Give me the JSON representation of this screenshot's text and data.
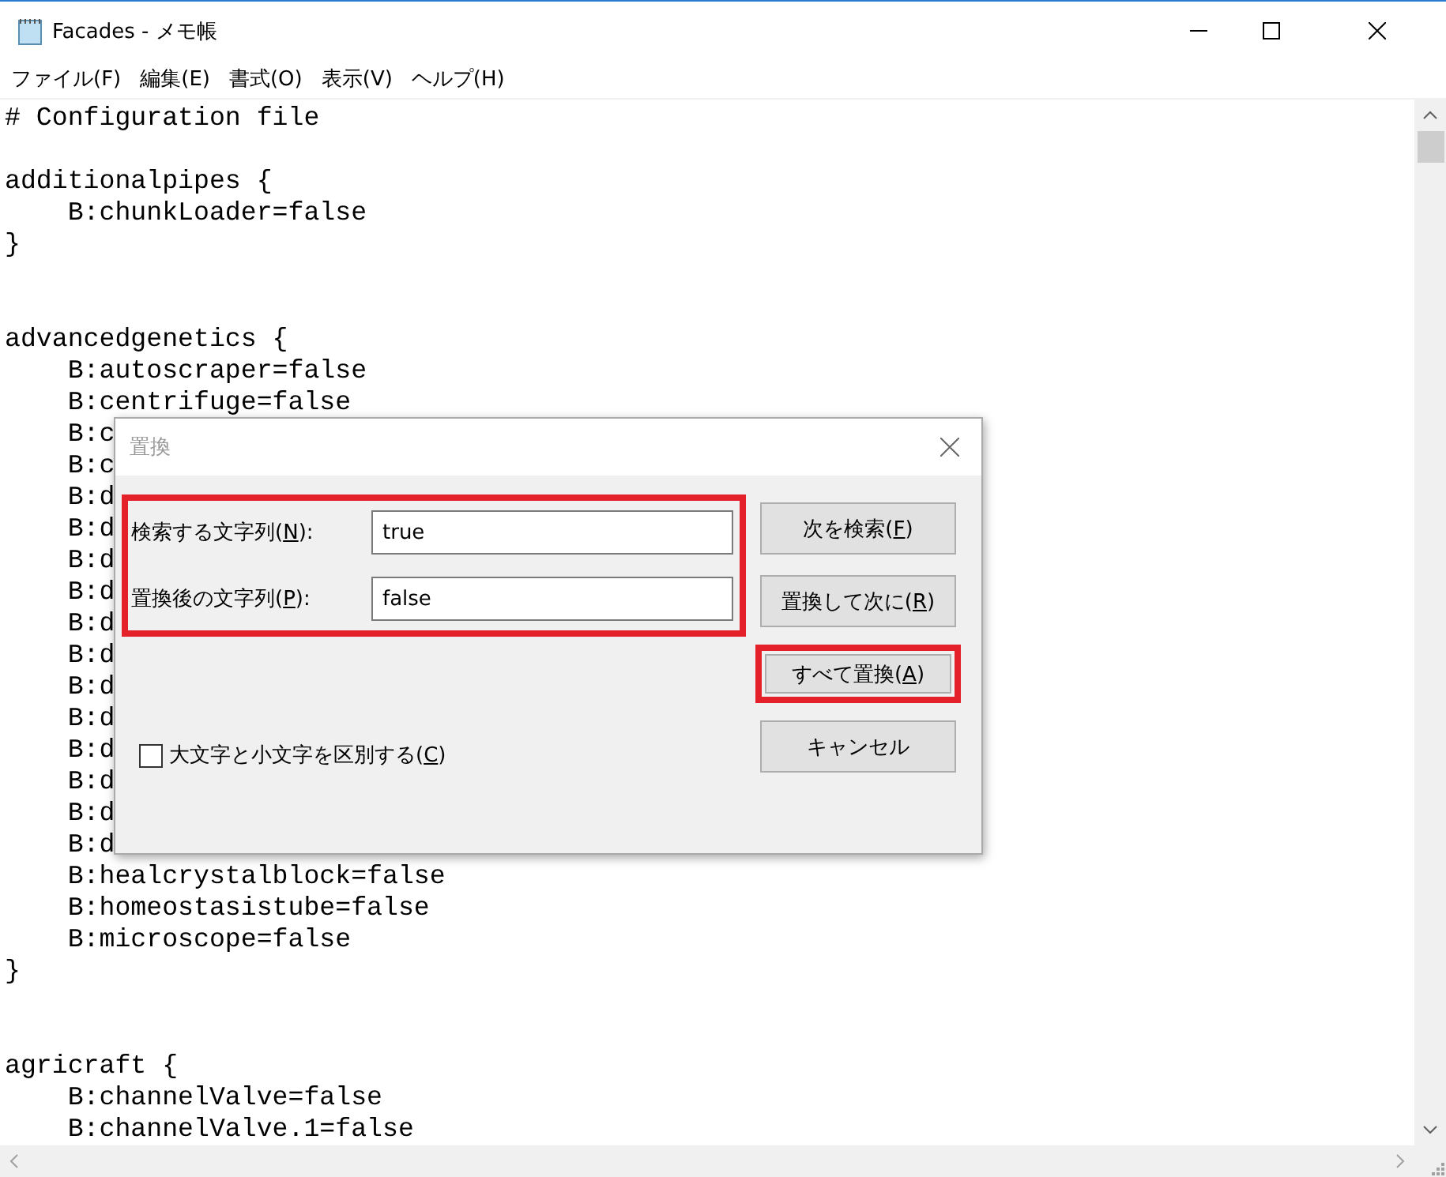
{
  "window": {
    "title": "Facades - メモ帳"
  },
  "menu": [
    "ファイル(F)",
    "編集(E)",
    "書式(O)",
    "表示(V)",
    "ヘルプ(H)"
  ],
  "editor": {
    "blocks": [
      {
        "lines": [
          "# Configuration file"
        ]
      },
      {
        "lines": [
          "additionalpipes {",
          "    B:chunkLoader=false",
          "}"
        ]
      },
      {
        "lines": [
          "advancedgenetics {",
          "    B:autoscraper=false",
          "    B:centrifuge=false",
          "    B:c",
          "    B:c",
          "    B:d",
          "    B:d",
          "    B:d",
          "    B:d",
          "    B:d",
          "    B:d",
          "    B:d",
          "    B:d",
          "    B:d",
          "    B:d",
          "    B:d",
          "    B:d",
          "    B:healcrystalblock=false",
          "    B:homeostasistube=false",
          "    B:microscope=false",
          "}"
        ]
      },
      {
        "lines": [
          "agricraft {",
          "    B:channelValve=false",
          "    B:channelValve.1=false"
        ]
      }
    ]
  },
  "replace_dialog": {
    "title": "置換",
    "fields_highlighted": true,
    "fields": [
      {
        "label": "検索する文字列(N):",
        "value": "true"
      },
      {
        "label": "置換後の文字列(P):",
        "value": "false"
      }
    ],
    "buttons": [
      {
        "label": "次を検索(F)",
        "highlighted": false
      },
      {
        "label": "置換して次に(R)",
        "highlighted": false
      },
      {
        "label": "すべて置換(A)",
        "highlighted": true
      },
      {
        "label": "キャンセル",
        "highlighted": false
      }
    ],
    "checkbox": {
      "label": "大文字と小文字を区別する(C)",
      "checked": false
    }
  }
}
